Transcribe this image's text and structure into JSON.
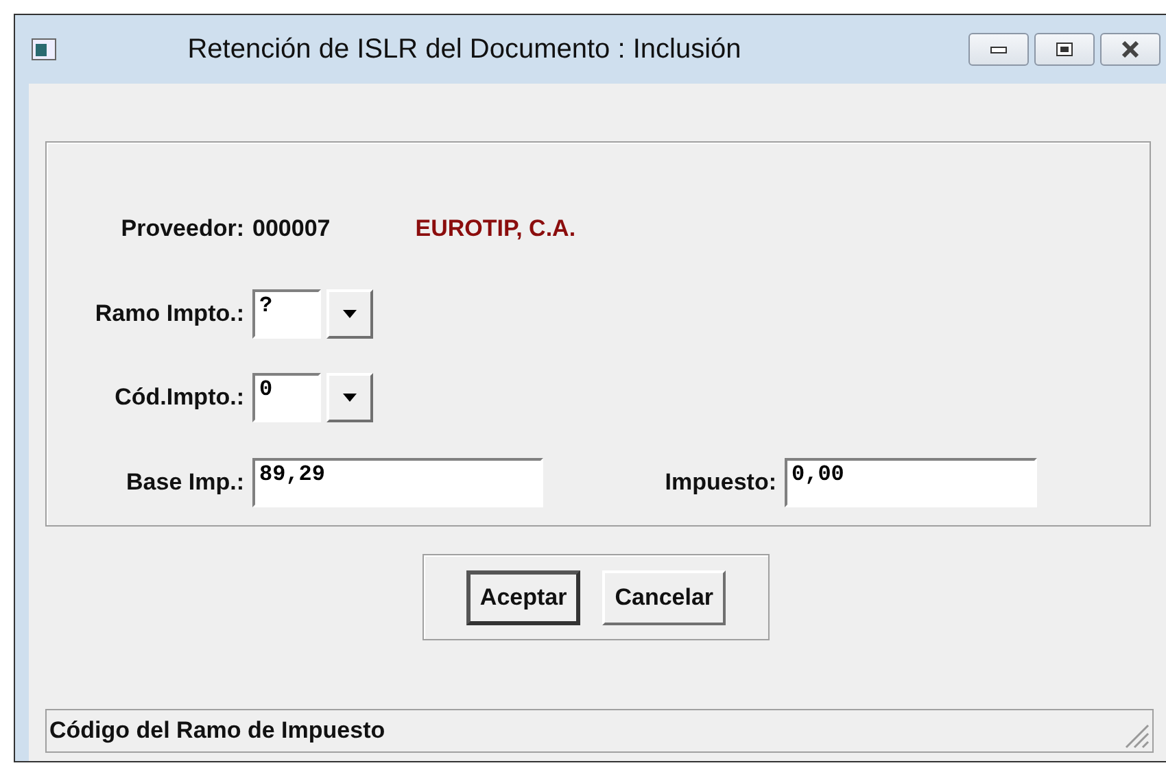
{
  "window": {
    "title": "Retención de ISLR del Documento : Inclusión"
  },
  "supplier": {
    "label": "Proveedor:",
    "code": "000007",
    "name": "EUROTIP, C.A."
  },
  "fields": [
    {
      "kind": "combo",
      "label": "Ramo Impto.:",
      "value": "?"
    },
    {
      "kind": "combo",
      "label": "Cód.Impto.:",
      "value": "0"
    },
    {
      "kind": "pair",
      "label": "Base Imp.:",
      "value": "89,29",
      "label_2": "Impuesto:",
      "value_2": "0,00"
    }
  ],
  "buttons": [
    {
      "label": "Aceptar",
      "selected": true
    },
    {
      "label": "Cancelar",
      "selected": false
    }
  ],
  "status_bar": "Código del Ramo de Impuesto"
}
